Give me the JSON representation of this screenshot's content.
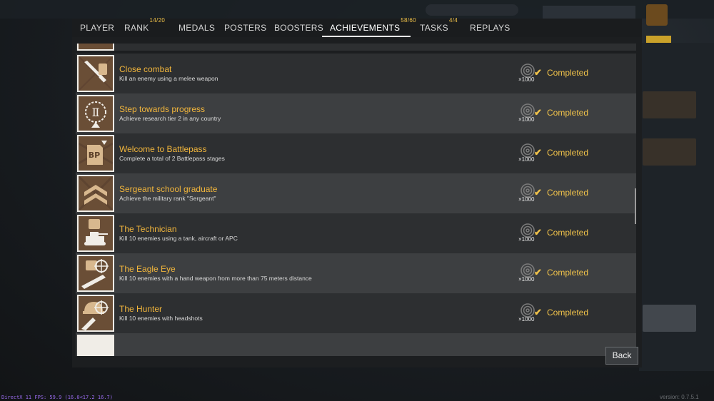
{
  "tabs": [
    {
      "label": "PLAYER",
      "badge": ""
    },
    {
      "label": "RANK",
      "badge": "14/20"
    },
    {
      "label": "MEDALS",
      "badge": ""
    },
    {
      "label": "POSTERS",
      "badge": ""
    },
    {
      "label": "BOOSTERS",
      "badge": ""
    },
    {
      "label": "ACHIEVEMENTS",
      "badge": "58/60"
    },
    {
      "label": "TASKS",
      "badge": "4/4"
    },
    {
      "label": "REPLAYS",
      "badge": ""
    }
  ],
  "active_tab": "ACHIEVEMENTS",
  "achievements": [
    {
      "title": "Close combat",
      "description": "Kill an enemy using a melee weapon",
      "reward": "×1000",
      "status": "Completed",
      "icon": "knife-icon"
    },
    {
      "title": "Step towards progress",
      "description": "Achieve research tier 2 in any country",
      "reward": "×1000",
      "status": "Completed",
      "icon": "tier-two-laurel-icon"
    },
    {
      "title": "Welcome to Battlepass",
      "description": "Complete a total of 2 Battlepass stages",
      "reward": "×1000",
      "status": "Completed",
      "icon": "battlepass-icon"
    },
    {
      "title": "Sergeant school graduate",
      "description": "Achieve the military rank \"Sergeant\"",
      "reward": "×1000",
      "status": "Completed",
      "icon": "sergeant-chevrons-icon"
    },
    {
      "title": "The Technician",
      "description": "Kill 10 enemies using a tank, aircraft or APC",
      "reward": "×1000",
      "status": "Completed",
      "icon": "tank-icon"
    },
    {
      "title": "The Eagle Eye",
      "description": "Kill 10 enemies with a hand weapon from more than 75 meters distance",
      "reward": "×1000",
      "status": "Completed",
      "icon": "scope-icon"
    },
    {
      "title": "The Hunter",
      "description": "Kill 10 enemies with headshots",
      "reward": "×1000",
      "status": "Completed",
      "icon": "headshot-icon"
    }
  ],
  "back_button": "Back",
  "footer": {
    "fps": "DirectX 11 FPS: 59.9 (16.0<17.2 16.7)",
    "version": "version: 0.7.5.1"
  },
  "colors": {
    "accent": "#f2b63c",
    "status": "#f0c24a",
    "row_dark": "#2d2f31",
    "row_light": "#3d3f41"
  }
}
